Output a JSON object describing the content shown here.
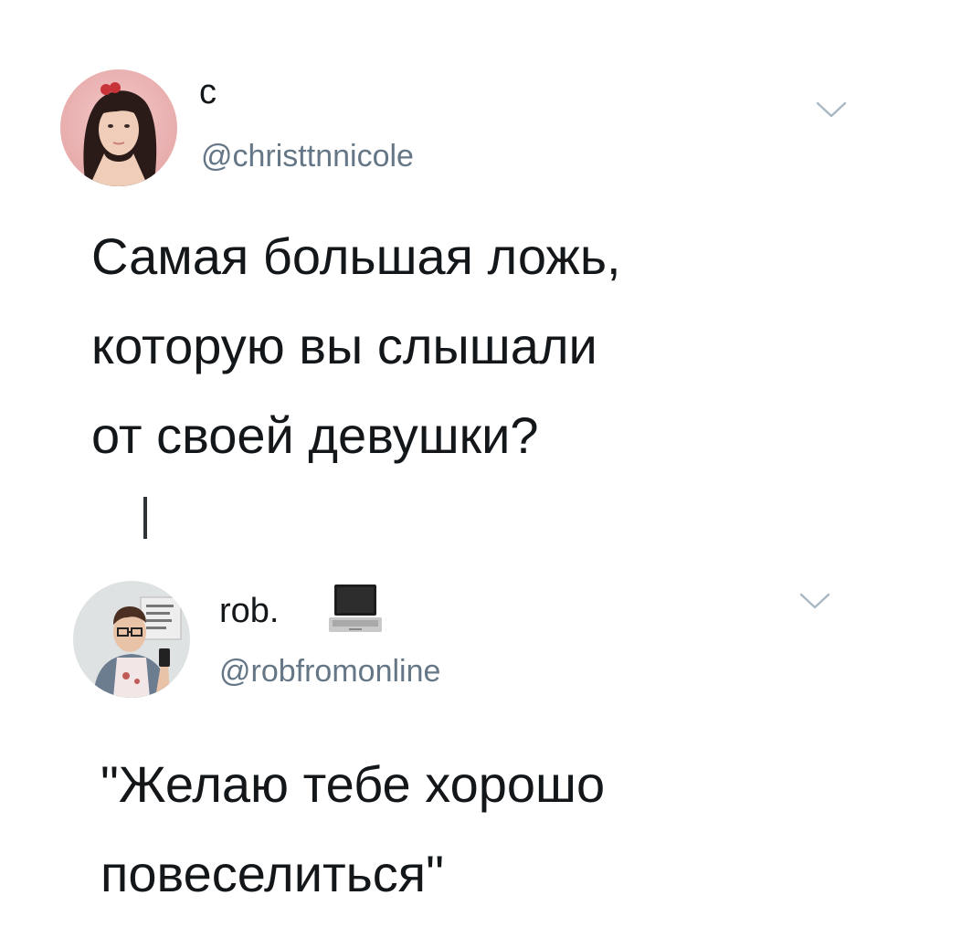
{
  "tweets": [
    {
      "display_name": "с",
      "handle": "@christtnnicole",
      "text": "Самая большая ложь,\nкоторую вы слышали\nот своей девушки?",
      "avatar_icon": "profile-photo-avatar",
      "menu_icon": "chevron-down-icon"
    },
    {
      "display_name": "rob.",
      "name_emoji": "laptop-icon",
      "handle": "@robfromonline",
      "text": "\"Желаю тебе хорошо\nповеселиться\"",
      "avatar_icon": "profile-photo-avatar",
      "menu_icon": "chevron-down-icon"
    }
  ],
  "colors": {
    "text_primary": "#14171a",
    "text_secondary": "#657786",
    "background": "#ffffff"
  }
}
